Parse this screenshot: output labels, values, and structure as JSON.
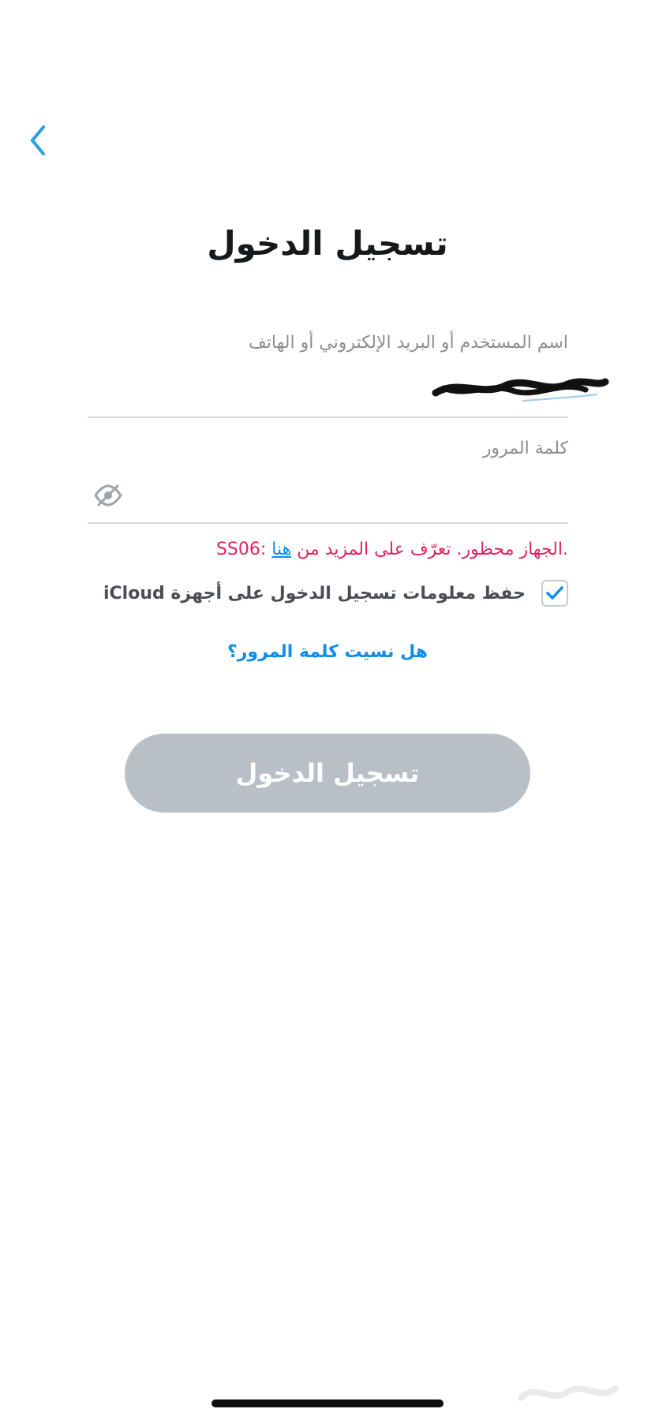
{
  "header": {
    "title": "تسجيل الدخول",
    "back_icon": "chevron-left-icon"
  },
  "form": {
    "username": {
      "label": "اسم المستخدم أو البريد الإلكتروني أو الهاتف",
      "value": ""
    },
    "password": {
      "label": "كلمة المرور",
      "value": "",
      "toggle_icon": "eye-off-icon"
    },
    "error": {
      "prefix": ".الجهاز محظور. تعرّف على المزيد من ",
      "link": "هنا",
      "code": " :SS06"
    },
    "remember": {
      "label": "حفظ معلومات تسجيل الدخول على أجهزة iCloud",
      "checked": true
    },
    "forgot_password": "هل نسيت كلمة المرور؟",
    "submit_label": "تسجيل الدخول"
  },
  "colors": {
    "accent": "#0f8de8",
    "error": "#e0245e",
    "button_disabled": "#b8bfc7"
  }
}
